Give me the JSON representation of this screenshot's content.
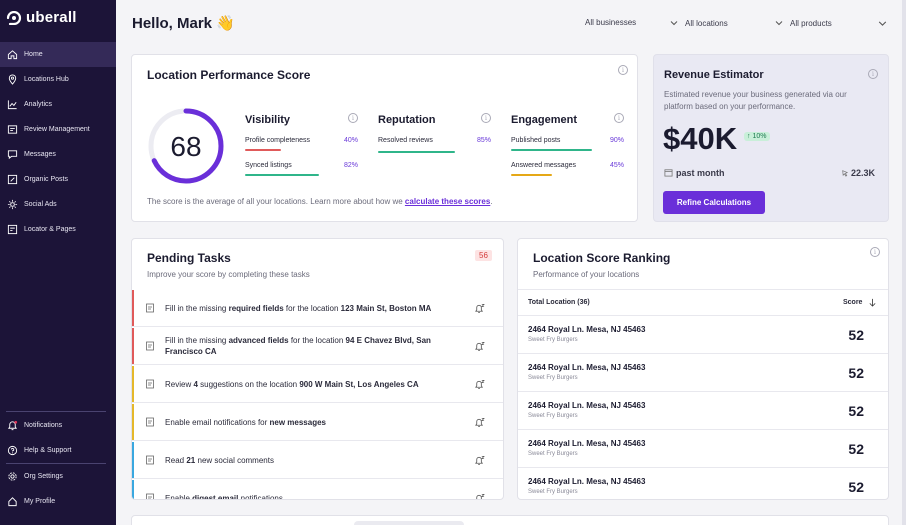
{
  "app": {
    "logo_text": "uberall"
  },
  "sidebar": {
    "items": [
      {
        "label": "Home",
        "icon": "home-icon"
      },
      {
        "label": "Locations Hub",
        "icon": "location-pin-icon"
      },
      {
        "label": "Analytics",
        "icon": "analytics-icon"
      },
      {
        "label": "Review Management",
        "icon": "review-icon"
      },
      {
        "label": "Messages",
        "icon": "messages-icon"
      },
      {
        "label": "Organic Posts",
        "icon": "posts-icon"
      },
      {
        "label": "Social Ads",
        "icon": "social-ads-icon"
      },
      {
        "label": "Locator & Pages",
        "icon": "locator-icon"
      }
    ],
    "bottom_items": [
      {
        "label": "Notifications",
        "icon": "bell-icon"
      },
      {
        "label": "Help & Support",
        "icon": "help-icon"
      },
      {
        "label": "Org Settings",
        "icon": "gear-icon"
      },
      {
        "label": "My Profile",
        "icon": "profile-icon"
      }
    ]
  },
  "header": {
    "greeting": "Hello, Mark 👋",
    "filters": [
      "All businesses",
      "All locations",
      "All products"
    ]
  },
  "performance": {
    "title": "Location Performance Score",
    "score": "68",
    "score_fraction": 0.68,
    "footnote_pre": "The score is the average of all your locations. Learn more about how we ",
    "footnote_link": "calculate these scores",
    "footnote_post": ".",
    "metrics": [
      {
        "title": "Visibility",
        "rows": [
          {
            "label": "Profile completeness",
            "value": "40%",
            "fraction": 0.4,
            "color": "#e05a5a"
          },
          {
            "label": "Synced listings",
            "value": "82%",
            "fraction": 0.82,
            "color": "#2fb58a"
          }
        ]
      },
      {
        "title": "Reputation",
        "rows": [
          {
            "label": "Resolved reviews",
            "value": "85%",
            "fraction": 0.85,
            "color": "#2fb58a"
          }
        ]
      },
      {
        "title": "Engagement",
        "rows": [
          {
            "label": "Published posts",
            "value": "90%",
            "fraction": 0.9,
            "color": "#2fb58a"
          },
          {
            "label": "Answered messages",
            "value": "45%",
            "fraction": 0.45,
            "color": "#e5a817"
          }
        ]
      }
    ]
  },
  "revenue": {
    "title": "Revenue Estimator",
    "description": "Estimated revenue your business generated via our platform based on your performance.",
    "amount": "$40K",
    "change": "10%",
    "period": "past month",
    "clicks": "22.3K",
    "button": "Refine Calculations"
  },
  "tasks": {
    "title": "Pending Tasks",
    "subtitle": "Improve your score by completing these tasks",
    "count": "56",
    "items": [
      {
        "parts": [
          "Fill in the missing ",
          "required fields",
          " for the location ",
          "123 Main St, Boston MA"
        ],
        "color": "#e05a5a"
      },
      {
        "parts": [
          "Fill in the missing ",
          "advanced fields",
          " for the location ",
          "94 E Chavez Blvd, San Francisco CA"
        ],
        "color": "#e05a5a"
      },
      {
        "parts": [
          "Review ",
          "4",
          " suggestions on the location ",
          "900 W Main St, Los Angeles CA"
        ],
        "color": "#e5b82a"
      },
      {
        "parts": [
          "Enable email notifications for ",
          "new messages",
          "",
          ""
        ],
        "color": "#e5b82a"
      },
      {
        "parts": [
          "Read ",
          "21",
          " new social comments",
          ""
        ],
        "color": "#3aa8e0"
      },
      {
        "parts": [
          "Enable ",
          "digest email",
          " notifications",
          ""
        ],
        "color": "#3aa8e0"
      }
    ]
  },
  "ranking": {
    "title": "Location Score Ranking",
    "subtitle": "Performance of your locations",
    "col_location": "Total Location (36)",
    "col_score": "Score",
    "rows": [
      {
        "address": "2464 Royal Ln. Mesa, NJ 45463",
        "brand": "Sweet Fry Burgers",
        "score": "52"
      },
      {
        "address": "2464 Royal Ln. Mesa, NJ 45463",
        "brand": "Sweet Fry Burgers",
        "score": "52"
      },
      {
        "address": "2464 Royal Ln. Mesa, NJ 45463",
        "brand": "Sweet Fry Burgers",
        "score": "52"
      },
      {
        "address": "2464 Royal Ln. Mesa, NJ 45463",
        "brand": "Sweet Fry Burgers",
        "score": "52"
      },
      {
        "address": "2464 Royal Ln. Mesa, NJ 45463",
        "brand": "Sweet Fry Burgers",
        "score": "52"
      }
    ]
  },
  "colors": {
    "accent": "#6a2fd9",
    "sidebar": "#1c1438",
    "good": "#2fb58a",
    "warn": "#e5a817",
    "bad": "#e05a5a"
  }
}
